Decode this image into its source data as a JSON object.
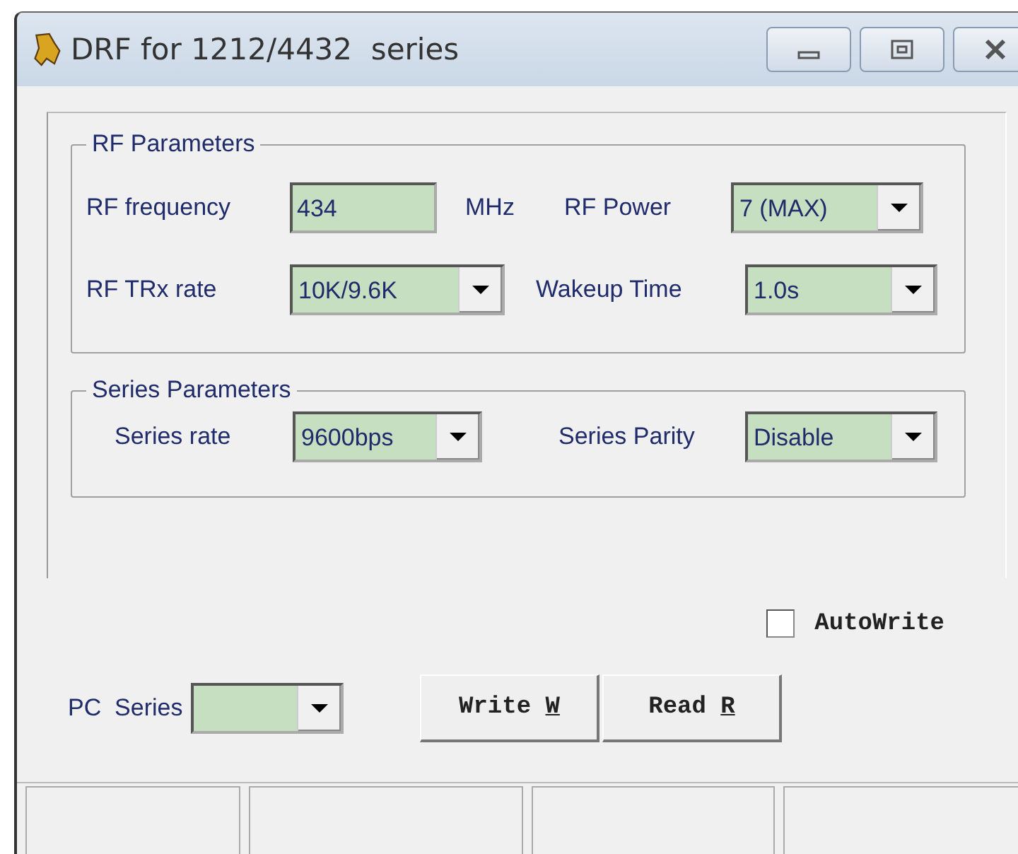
{
  "window": {
    "title": "DRF for 1212/4432  series"
  },
  "rf_parameters": {
    "title": "RF Parameters",
    "frequency": {
      "label": "RF frequency",
      "value": "434",
      "unit": "MHz"
    },
    "power": {
      "label": "RF Power",
      "value": "7 (MAX)"
    },
    "trx_rate": {
      "label": "RF TRx rate",
      "value": "10K/9.6K"
    },
    "wakeup_time": {
      "label": "Wakeup Time",
      "value": "1.0s"
    }
  },
  "series_parameters": {
    "title": "Series  Parameters",
    "rate": {
      "label": "Series rate",
      "value": "9600bps"
    },
    "parity": {
      "label": "Series Parity",
      "value": "Disable"
    }
  },
  "autowrite": {
    "label": "AutoWrite",
    "checked": false
  },
  "pc_series": {
    "label": "PC  Series"
  },
  "buttons": [
    {
      "label": "Write ",
      "mnemonic": "W"
    },
    {
      "label": "Read ",
      "mnemonic": "R"
    }
  ]
}
